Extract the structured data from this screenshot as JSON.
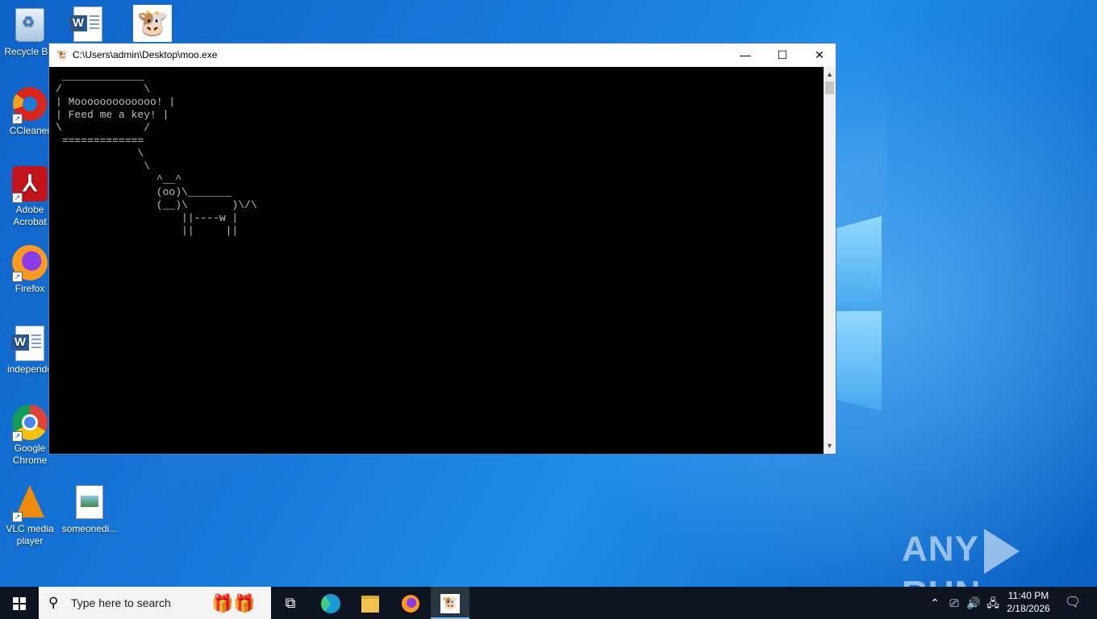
{
  "desktop": {
    "icons": [
      {
        "label": "Recycle Bin",
        "icon": "recycle-bin-icon"
      },
      {
        "label": "",
        "icon": "word-document-icon"
      },
      {
        "label": "",
        "icon": "cow-icon"
      },
      {
        "label": "CCleaner",
        "icon": "ccleaner-icon"
      },
      {
        "label": "Adobe Acrobat",
        "icon": "adobe-acrobat-icon"
      },
      {
        "label": "Firefox",
        "icon": "firefox-icon"
      },
      {
        "label": "independe",
        "icon": "word-document-icon"
      },
      {
        "label": "Google Chrome",
        "icon": "chrome-icon"
      },
      {
        "label": "VLC media player",
        "icon": "vlc-icon"
      },
      {
        "label": "someonedi...",
        "icon": "image-file-icon"
      }
    ]
  },
  "window": {
    "title": "C:\\Users\\admin\\Desktop\\moo.exe",
    "controls": {
      "minimize": "—",
      "maximize": "☐",
      "close": "✕"
    },
    "console_text": " _____________\n/             \\\n| Mooooooooooooo! |\n| Feed me a key! |\n\\             /\n =============\n             \\\n              \\\n                ^__^\n                (oo)\\_______\n                (__)\\       )\\/\\\n                    ||----w |\n                    ||     ||"
  },
  "watermark": {
    "left": "ANY",
    "right": "RUN"
  },
  "taskbar": {
    "search_placeholder": "Type here to search",
    "clock_time": "11:40 PM",
    "clock_date": "2/18/2026",
    "pinned": [
      {
        "name": "task-view",
        "icon": "task-view-icon"
      },
      {
        "name": "edge",
        "icon": "edge-icon"
      },
      {
        "name": "file-explorer",
        "icon": "folder-icon"
      },
      {
        "name": "firefox",
        "icon": "firefox-icon"
      },
      {
        "name": "moo",
        "icon": "cow-icon",
        "active": true
      }
    ]
  },
  "colors": {
    "desktop_blue": "#1677d9",
    "console_bg": "#000000",
    "console_text": "#c0c0c0",
    "taskbar_bg": "#0d1620",
    "active_underline": "#76b9ed"
  }
}
